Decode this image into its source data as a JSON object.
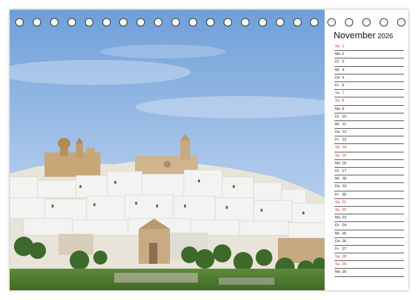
{
  "calendar": {
    "month": "November",
    "year": "2026",
    "days": [
      {
        "wd": "So",
        "d": "1",
        "weekend": true
      },
      {
        "wd": "Mo",
        "d": "2",
        "weekend": false
      },
      {
        "wd": "Di",
        "d": "3",
        "weekend": false
      },
      {
        "wd": "Mi",
        "d": "4",
        "weekend": false
      },
      {
        "wd": "Do",
        "d": "5",
        "weekend": false
      },
      {
        "wd": "Fr",
        "d": "6",
        "weekend": false
      },
      {
        "wd": "Sa",
        "d": "7",
        "weekend": true
      },
      {
        "wd": "So",
        "d": "8",
        "weekend": true
      },
      {
        "wd": "Mo",
        "d": "9",
        "weekend": false
      },
      {
        "wd": "Di",
        "d": "10",
        "weekend": false
      },
      {
        "wd": "Mi",
        "d": "11",
        "weekend": false
      },
      {
        "wd": "Do",
        "d": "12",
        "weekend": false
      },
      {
        "wd": "Fr",
        "d": "13",
        "weekend": false
      },
      {
        "wd": "Sa",
        "d": "14",
        "weekend": true
      },
      {
        "wd": "So",
        "d": "15",
        "weekend": true
      },
      {
        "wd": "Mo",
        "d": "16",
        "weekend": false
      },
      {
        "wd": "Di",
        "d": "17",
        "weekend": false
      },
      {
        "wd": "Mi",
        "d": "18",
        "weekend": false
      },
      {
        "wd": "Do",
        "d": "19",
        "weekend": false
      },
      {
        "wd": "Fr",
        "d": "20",
        "weekend": false
      },
      {
        "wd": "Sa",
        "d": "21",
        "weekend": true
      },
      {
        "wd": "So",
        "d": "22",
        "weekend": true
      },
      {
        "wd": "Mo",
        "d": "23",
        "weekend": false
      },
      {
        "wd": "Di",
        "d": "24",
        "weekend": false
      },
      {
        "wd": "Mi",
        "d": "25",
        "weekend": false
      },
      {
        "wd": "Do",
        "d": "26",
        "weekend": false
      },
      {
        "wd": "Fr",
        "d": "27",
        "weekend": false
      },
      {
        "wd": "Sa",
        "d": "28",
        "weekend": true
      },
      {
        "wd": "So",
        "d": "29",
        "weekend": true
      },
      {
        "wd": "Mo",
        "d": "30",
        "weekend": false
      }
    ]
  },
  "colors": {
    "weekend": "#c0302a",
    "weekday": "#222222",
    "sky_top": "#6f9fd8",
    "sky_bottom": "#bcd3ec"
  },
  "binding": {
    "ring_count": 23
  }
}
